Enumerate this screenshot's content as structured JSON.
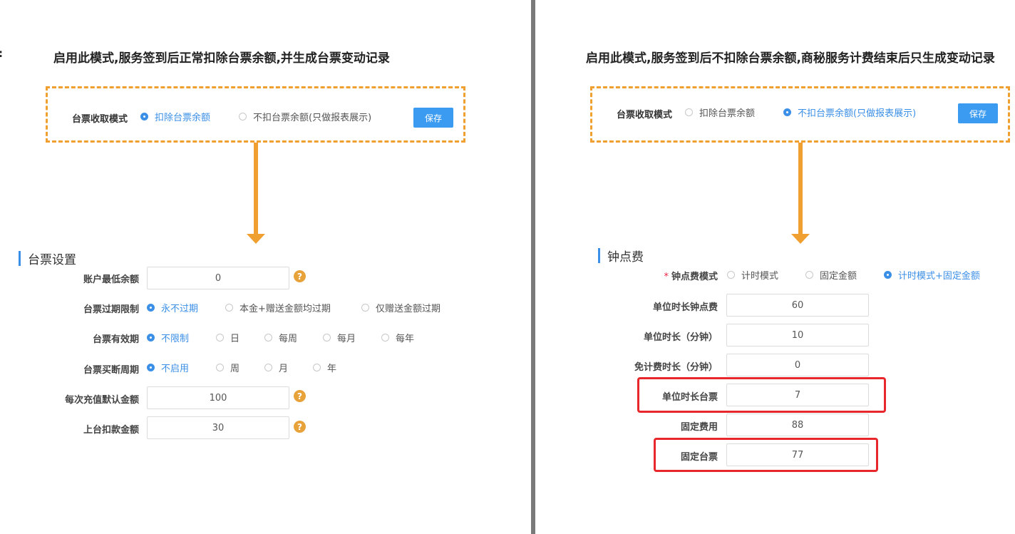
{
  "left": {
    "stray_char": ":",
    "heading": "启用此模式,服务签到后正常扣除台票余额,并生成台票变动记录",
    "mode_label": "台票收取模式",
    "mode_options": [
      "扣除台票余额",
      "不扣台票余额(只做报表展示)"
    ],
    "mode_selected": 0,
    "save_label": "保存",
    "section_title": "台票设置",
    "fields": {
      "min_balance": {
        "label": "账户最低余额",
        "value": "0"
      },
      "expiry_limit": {
        "label": "台票过期限制",
        "options": [
          "永不过期",
          "本金+赠送金额均过期",
          "仅赠送金额过期"
        ],
        "selected": 0
      },
      "validity": {
        "label": "台票有效期",
        "options": [
          "不限制",
          "日",
          "每周",
          "每月",
          "每年"
        ],
        "selected": 0
      },
      "buyout_cycle": {
        "label": "台票买断周期",
        "options": [
          "不启用",
          "周",
          "月",
          "年"
        ],
        "selected": 0
      },
      "default_recharge": {
        "label": "每次充值默认金额",
        "value": "100"
      },
      "deduct_amount": {
        "label": "上台扣款金额",
        "value": "30"
      }
    },
    "help_glyph": "?"
  },
  "right": {
    "heading": "启用此模式,服务签到后不扣除台票余额,商秘服务计费结束后只生成变动记录",
    "mode_label": "台票收取模式",
    "mode_options": [
      "扣除台票余额",
      "不扣台票余额(只做报表展示)"
    ],
    "mode_selected": 1,
    "save_label": "保存",
    "section_title": "钟点费",
    "fields": {
      "fee_mode": {
        "required_mark": "*",
        "label": "钟点费模式",
        "options": [
          "计时模式",
          "固定金额",
          "计时模式+固定金额"
        ],
        "selected": 2
      },
      "unit_fee": {
        "label": "单位时长钟点费",
        "value": "60"
      },
      "unit_minutes": {
        "label": "单位时长（分钟）",
        "value": "10"
      },
      "free_minutes": {
        "label": "免计费时长（分钟）",
        "value": "0"
      },
      "unit_ticket": {
        "label": "单位时长台票",
        "value": "7"
      },
      "fixed_fee": {
        "label": "固定费用",
        "value": "88"
      },
      "fixed_ticket": {
        "label": "固定台票",
        "value": "77"
      }
    }
  },
  "colors": {
    "accent": "#3b8fe6",
    "dash_orange": "#f0a030",
    "highlight_red": "#e8272d",
    "help_orange": "#e8a23a"
  }
}
